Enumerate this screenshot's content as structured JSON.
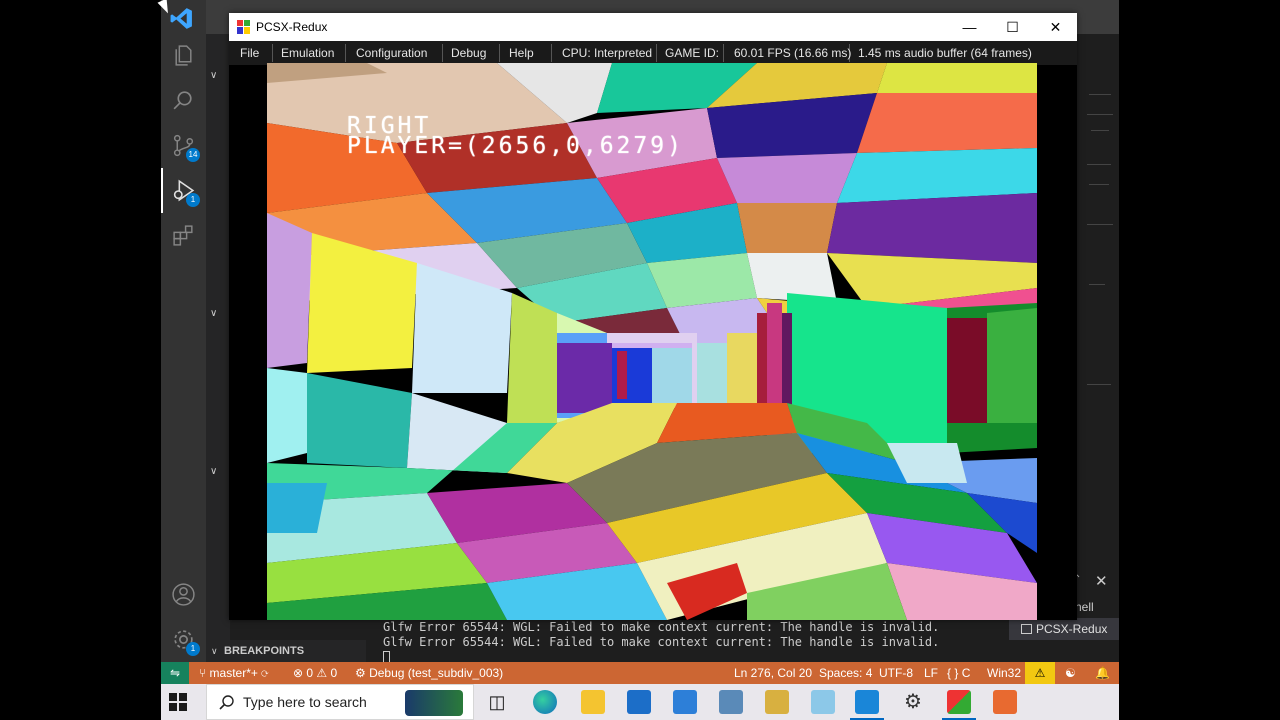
{
  "vscode": {
    "activity_badges": {
      "source_control": "14",
      "debug": "1",
      "settings": "1"
    },
    "breakpoints_label": "BREAKPOINTS",
    "terminal_lines": [
      "Glfw Error 65544: WGL: Failed to make context current: The handle is invalid.",
      "Glfw Error 65544: WGL: Failed to make context current: The handle is invalid."
    ],
    "terminal_partial": "hell",
    "terminal_tab": "PCSX-Redux",
    "status": {
      "branch": "master*+",
      "problems": "0",
      "warnings": "0",
      "debug": "Debug (test_subdiv_003)",
      "position": "Ln 276, Col 20",
      "spaces": "Spaces: 4",
      "encoding": "UTF-8",
      "eol": "LF",
      "language": "C",
      "platform": "Win32"
    }
  },
  "pcsx": {
    "title": "PCSX-Redux",
    "menu": [
      "File",
      "Emulation",
      "Configuration",
      "Debug",
      "Help"
    ],
    "cpu": "CPU: Interpreted",
    "game_id": "GAME ID:",
    "fps": "60.01 FPS (16.66 ms)",
    "audio": "1.45 ms audio buffer (64 frames)",
    "hud_line1": "RIGHT",
    "hud_line2": "PLAYER=(2656,0,6279)"
  },
  "taskbar": {
    "search_placeholder": "Type here to search"
  },
  "colors": {
    "status_bar": "#cc6633",
    "remote": "#16825d",
    "vscode_bg": "#1e1e1e",
    "activity_bar": "#333333"
  }
}
